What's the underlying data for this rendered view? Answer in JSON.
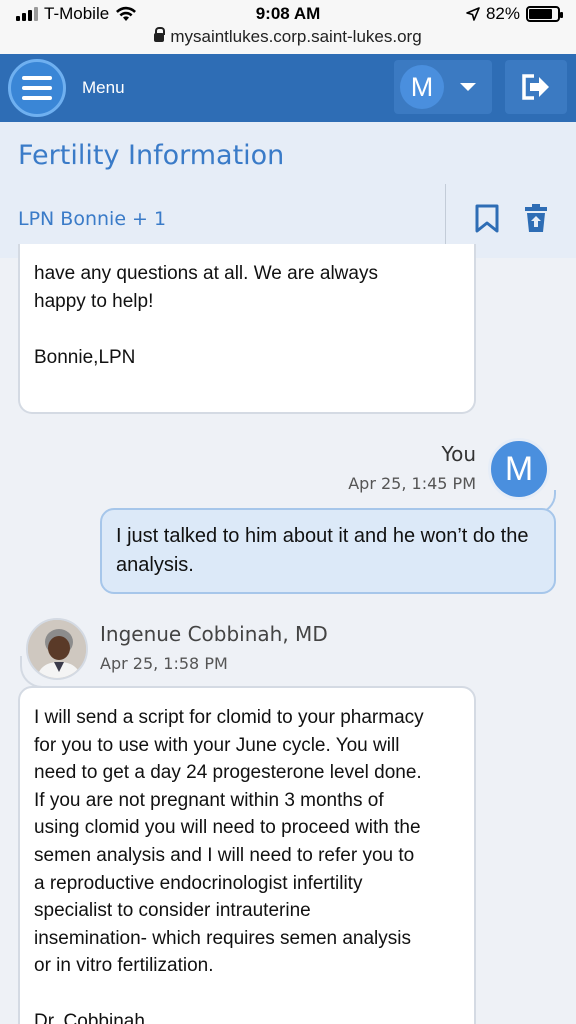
{
  "status_bar": {
    "carrier": "T-Mobile",
    "time": "9:08 AM",
    "battery": "82%",
    "battery_level": 0.82,
    "url": "mysaintlukes.corp.saint-lukes.org"
  },
  "header": {
    "menu_label": "Menu",
    "user_initial": "M"
  },
  "conversation": {
    "subject": "Fertility Information",
    "participants": "LPN Bonnie + 1"
  },
  "messages": [
    {
      "text": "have any questions at all. We are always\nhappy to help!\n\nBonnie,LPN"
    },
    {
      "sender": "You",
      "timestamp": "Apr 25, 1:45 PM",
      "avatar_initial": "M",
      "text": "I just talked to him about it and he won’t do the analysis."
    },
    {
      "sender": "Ingenue Cobbinah, MD",
      "timestamp": "Apr 25, 1:58 PM",
      "text": "I will send a script for clomid to your pharmacy\nfor you to use with your June cycle.  You will\nneed to get a day 24 progesterone level done.\nIf you are not pregnant within 3 months of\nusing clomid you will need to proceed with the\nsemen analysis and I will need to refer you to\na reproductive endocrinologist infertility\nspecialist to consider intrauterine\ninsemination- which requires semen analysis\nor in vitro fertilization.\n\nDr. Cobbinah"
    }
  ]
}
